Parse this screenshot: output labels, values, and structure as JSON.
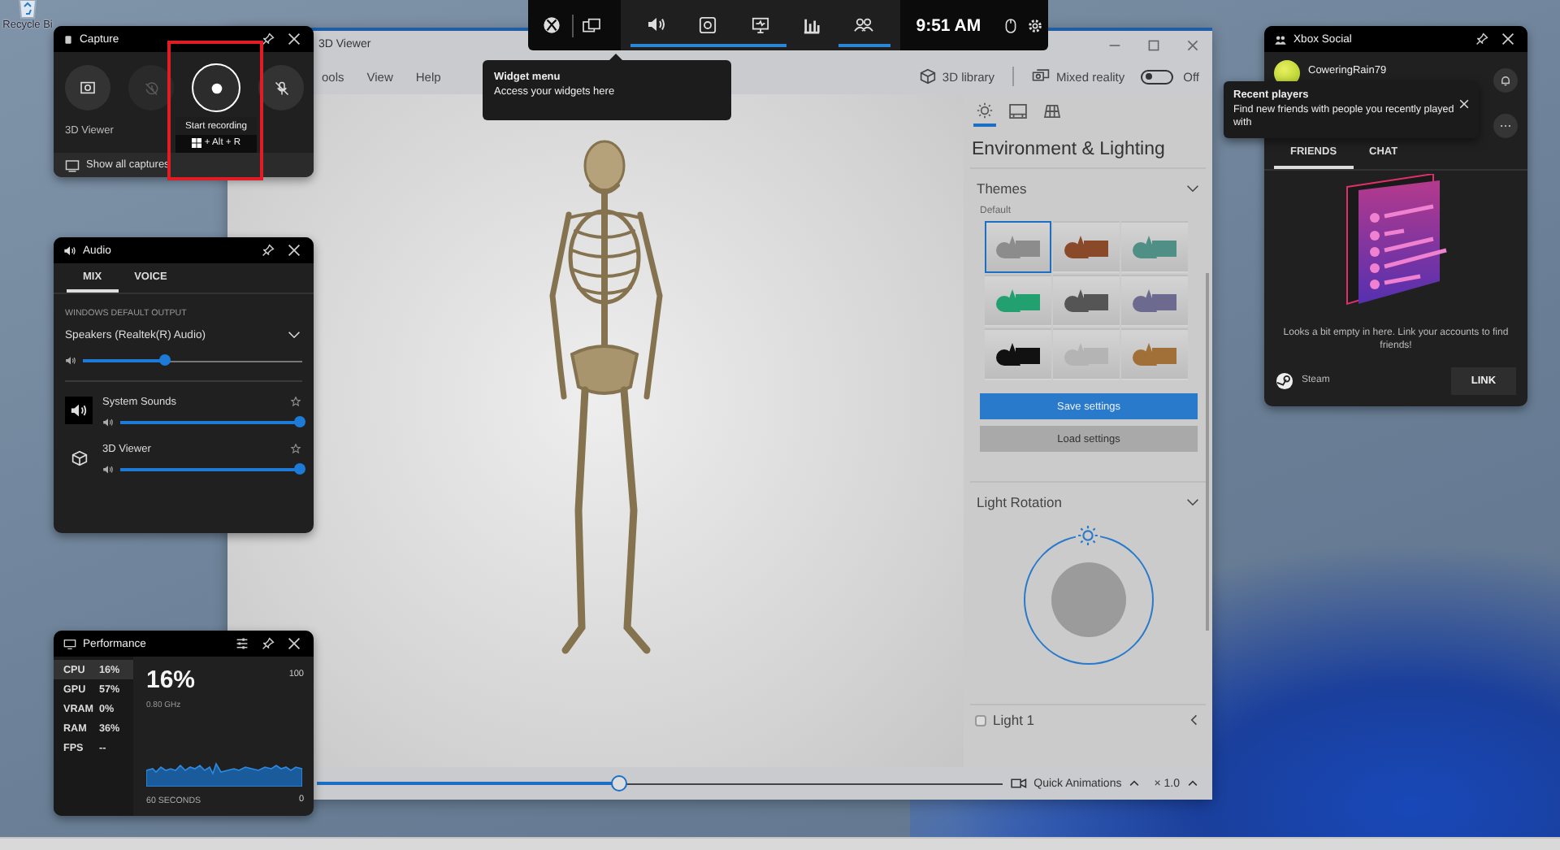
{
  "desktop": {
    "recycle_bin_label": "Recycle Bi"
  },
  "viewer": {
    "title": "3D Viewer",
    "menu": [
      "ools",
      "View",
      "Help"
    ],
    "library": "3D library",
    "mixed_reality": {
      "label": "Mixed reality",
      "on": false,
      "state": "Off"
    },
    "panel": {
      "tabs": [
        {
          "selected": true
        },
        {
          "selected": false
        },
        {
          "selected": false
        }
      ],
      "heading": "Environment & Lighting",
      "themes_title": "Themes",
      "themes_subtitle": "Default",
      "themes": [
        {
          "selected": true,
          "color": "#8c8c8c"
        },
        {
          "selected": false,
          "color": "#8a4a2a"
        },
        {
          "selected": false,
          "color": "#4f8f86"
        },
        {
          "selected": false,
          "color": "#22a070"
        },
        {
          "selected": false,
          "color": "#555555"
        },
        {
          "selected": false,
          "color": "#6c6a8e"
        },
        {
          "selected": false,
          "color": "#111111"
        },
        {
          "selected": false,
          "color": "#b4b4b4"
        },
        {
          "selected": false,
          "color": "#a07038"
        }
      ],
      "save": "Save settings",
      "load": "Load settings",
      "rotation": "Light Rotation",
      "lights": [
        {
          "label": "Light 1",
          "checked": false
        }
      ]
    },
    "timeline": {
      "level": 0.44
    },
    "animations": "Quick Animations",
    "speed": "× 1.0"
  },
  "game_bar": {
    "widgets": [
      {
        "on": true
      },
      {
        "on": true
      },
      {
        "on": true
      },
      {
        "on": false
      },
      {
        "on": true
      }
    ],
    "time": "9:51 AM"
  },
  "widget_tooltip": {
    "title": "Widget menu",
    "text": "Access your widgets here"
  },
  "capture": {
    "title": "Capture",
    "buttons": [
      {
        "disabled": false
      },
      {
        "disabled": true
      },
      {
        "disabled": false
      },
      {
        "disabled": false
      }
    ],
    "app": "3D Viewer",
    "tooltip": "Start recording",
    "shortcut": "+ Alt + R",
    "show_all": "Show all captures"
  },
  "audio": {
    "title": "Audio",
    "tabs": [
      {
        "label": "MIX",
        "selected": true
      },
      {
        "label": "VOICE",
        "selected": false
      }
    ],
    "section": "WINDOWS DEFAULT OUTPUT",
    "device": "Speakers (Realtek(R) Audio)",
    "master": {
      "level": 0.38
    },
    "apps": [
      {
        "kind": "system",
        "name": "System Sounds",
        "level": 1
      },
      {
        "kind": "app",
        "name": "3D Viewer",
        "level": 1
      }
    ]
  },
  "performance": {
    "title": "Performance",
    "metrics": [
      {
        "label": "CPU",
        "value": "16%",
        "selected": true
      },
      {
        "label": "GPU",
        "value": "57%",
        "selected": false
      },
      {
        "label": "VRAM",
        "value": "0%",
        "selected": false
      },
      {
        "label": "RAM",
        "value": "36%",
        "selected": false
      },
      {
        "label": "FPS",
        "value": "--",
        "selected": false
      }
    ],
    "reading": "16%",
    "clock": "0.80 GHz",
    "max": "100",
    "min": "0",
    "span": "60 SECONDS"
  },
  "social": {
    "title": "Xbox Social",
    "user": "CoweringRain79",
    "tooltip": {
      "title": "Recent players",
      "text": "Find new friends with people you recently played with"
    },
    "tabs": [
      {
        "label": "FRIENDS",
        "selected": true
      },
      {
        "label": "CHAT",
        "selected": false
      }
    ],
    "empty": "Looks a bit empty in here. Link your accounts to find friends!",
    "account": "Steam",
    "link": "LINK"
  }
}
